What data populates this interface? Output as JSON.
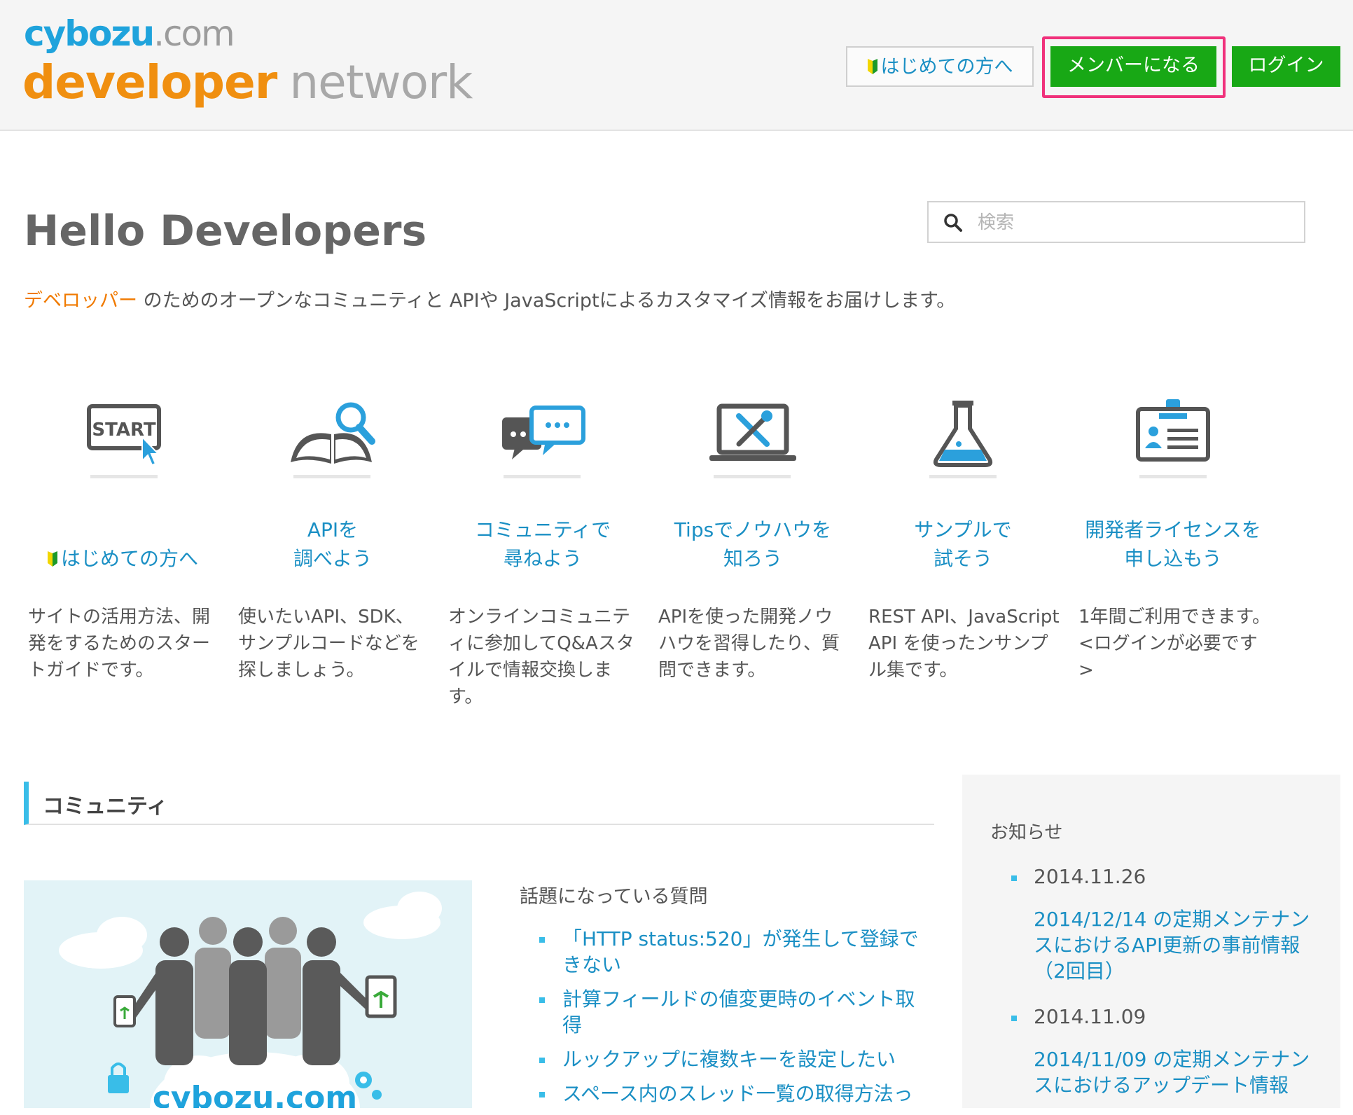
{
  "logo": {
    "top_bold": "cybozu",
    "top_dim": ".com",
    "bottom_dev": "developer",
    "bottom_net": "network"
  },
  "header": {
    "beginner_label": "はじめての方へ",
    "member_label": "メンバーになる",
    "login_label": "ログイン"
  },
  "hero": {
    "title": "Hello Developers",
    "search_placeholder": "検索",
    "tagline_highlight": "デベロッパー",
    "tagline_rest": " のためのオープンなコミュニティと APIや JavaScriptによるカスタマイズ情報をお届けします。"
  },
  "features": [
    {
      "icon": "start-icon",
      "title": "はじめての方へ",
      "desc": "サイトの活用方法、開発をするためのスタートガイドです。"
    },
    {
      "icon": "book-search-icon",
      "title": "APIを\n調べよう",
      "desc": "使いたいAPI、SDK、サンプルコードなどを探しましょう。"
    },
    {
      "icon": "chat-bubbles-icon",
      "title": "コミュニティで\n尋ねよう",
      "desc": "オンラインコミュニティに参加してQ&Aスタイルで情報交換します。"
    },
    {
      "icon": "laptop-tools-icon",
      "title": "Tipsでノウハウを\n知ろう",
      "desc": "APIを使った開発ノウハウを習得したり、質問できます。"
    },
    {
      "icon": "flask-icon",
      "title": "サンプルで\n試そう",
      "desc": "REST API、JavaScript API を使ったンサンプル集です。"
    },
    {
      "icon": "license-card-icon",
      "title": "開発者ライセンスを\n申し込もう",
      "desc": "1年間ご利用できます。<ログインが必要です>"
    }
  ],
  "community": {
    "heading": "コミュニティ",
    "image_text": "cybozu.com",
    "qa_title": "話題になっている質問",
    "questions": [
      "「HTTP status:520」が発生して登録できない",
      "計算フィールドの値変更時のイベント取得",
      "ルックアップに複数キーを設定したい",
      "スペース内のスレッド一覧の取得方法っ"
    ]
  },
  "news": {
    "title": "お知らせ",
    "items": [
      {
        "date": "2014.11.26",
        "link": "2014/12/14 の定期メンテナンスにおけるAPI更新の事前情報（2回目）"
      },
      {
        "date": "2014.11.09",
        "link": "2014/11/09 の定期メンテナンスにおけるアップデート情報"
      }
    ]
  },
  "colors": {
    "accent_blue": "#1a8fc4",
    "brand_orange": "#f08f10",
    "green": "#18a815",
    "highlight": "#f0317b"
  }
}
